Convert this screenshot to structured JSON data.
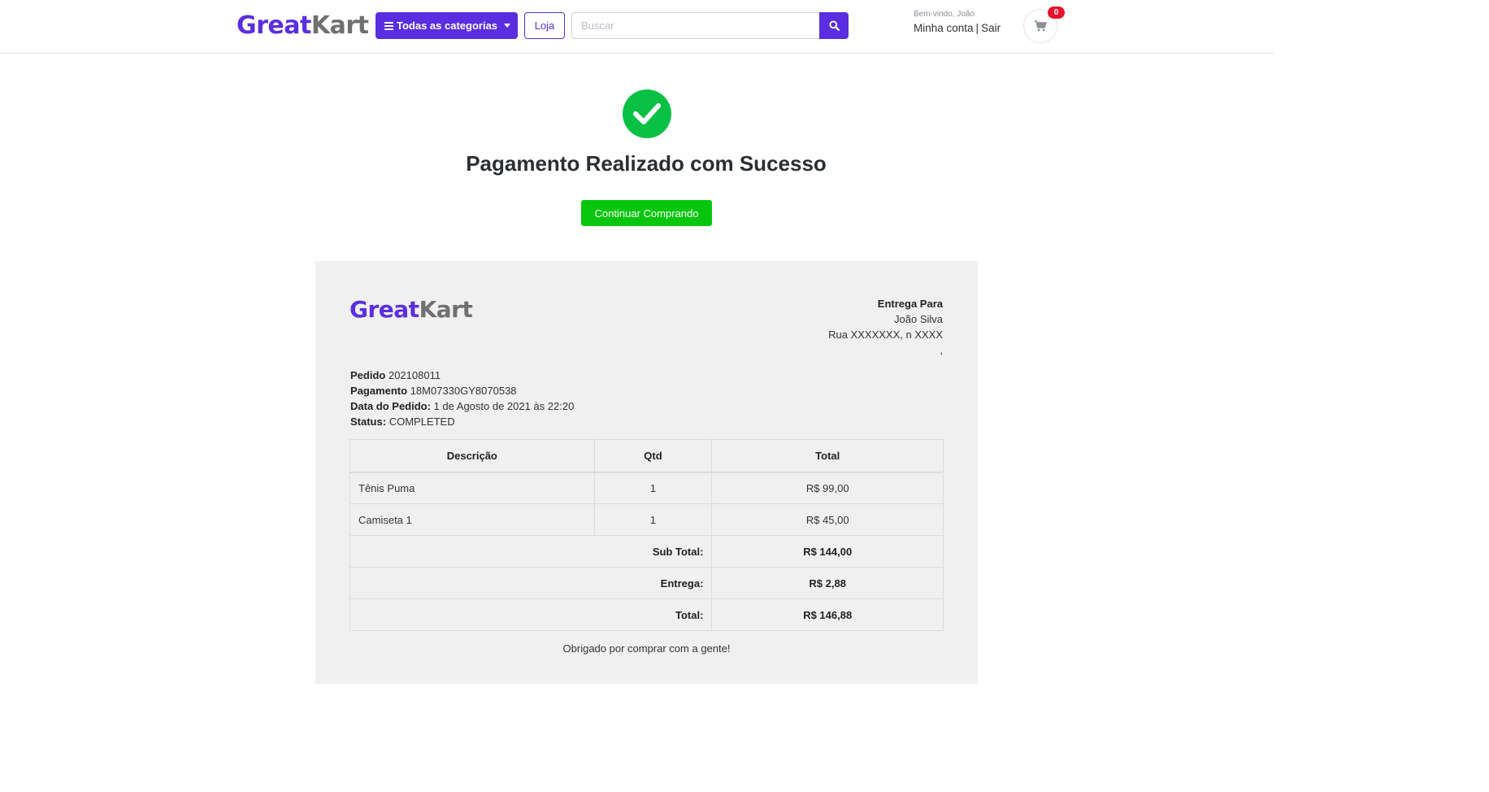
{
  "header": {
    "logo_great": "Great",
    "logo_kart": "Kart",
    "categories_label": "Todas as categorias",
    "shop_label": "Loja",
    "search_placeholder": "Buscar",
    "welcome": "Bem-vindo, João",
    "my_account": "Minha conta",
    "separator": "|",
    "logout": "Sair",
    "cart_count": "0",
    "icons": {
      "menu": "bars-icon",
      "search": "search-icon",
      "cart": "cart-icon"
    }
  },
  "success": {
    "icon": "check-circle-icon",
    "title": "Pagamento Realizado com Sucesso",
    "continue_label": "Continuar Comprando"
  },
  "invoice": {
    "logo_great": "Great",
    "logo_kart": "Kart",
    "ship_title": "Entrega Para",
    "ship_name": "João Silva",
    "ship_address": "Rua XXXXXXX, n XXXX",
    "ship_city": ",",
    "order_label": "Pedido",
    "order_value": "202108011",
    "payment_label": "Pagamento",
    "payment_value": "18M07330GY8070538",
    "date_label": "Data do Pedido:",
    "date_value": "1 de Agosto de 2021 às 22:20",
    "status_label": "Status:",
    "status_value": "COMPLETED",
    "columns": [
      "Descrição",
      "Qtd",
      "Total"
    ],
    "rows": [
      {
        "desc": "Tênis Puma",
        "qty": "1",
        "total": "R$ 99,00"
      },
      {
        "desc": "Camiseta 1",
        "qty": "1",
        "total": "R$ 45,00"
      }
    ],
    "subtotal_label": "Sub Total:",
    "subtotal_value": "R$ 144,00",
    "shipping_label": "Entrega:",
    "shipping_value": "R$ 2,88",
    "total_label": "Total:",
    "total_value": "R$ 146,88",
    "thanks": "Obrigado por comprar com a gente!"
  },
  "colors": {
    "brand": "#5a2ee0",
    "success": "#08c144",
    "continue_button": "#08c60d",
    "badge": "#e8112d",
    "invoice_bg": "#f0f0f0"
  }
}
